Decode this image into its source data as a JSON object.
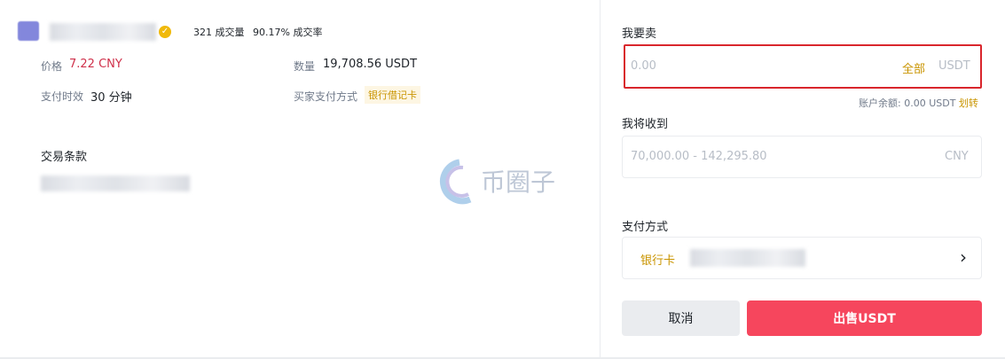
{
  "merchant": {
    "orders_count": "321 成交量",
    "completion_rate": "90.17% 成交率"
  },
  "info": {
    "price_label": "价格",
    "price_value": "7.22 CNY",
    "quantity_label": "数量",
    "quantity_value": "19,708.56 USDT",
    "payment_time_label": "支付时效",
    "payment_time_value": "30 分钟",
    "buyer_payment_label": "买家支付方式",
    "buyer_payment_value": "银行借记卡"
  },
  "terms": {
    "title": "交易条款"
  },
  "watermark": {
    "text": "币圈子"
  },
  "form": {
    "sell_label": "我要卖",
    "sell_placeholder": "0.00",
    "sell_all": "全部",
    "sell_unit": "USDT",
    "balance_text": "账户余额: 0.00 USDT",
    "transfer": "划转",
    "receive_label": "我将收到",
    "receive_placeholder": "70,000.00 - 142,295.80",
    "receive_unit": "CNY",
    "payment_label": "支付方式",
    "payment_value": "银行卡",
    "chevron": "›",
    "cancel_button": "取消",
    "sell_button": "出售USDT"
  },
  "colors": {
    "accent": "#f0b90b",
    "sell": "#f6465d",
    "price": "#cf304a",
    "focus_border": "#d9262c"
  }
}
